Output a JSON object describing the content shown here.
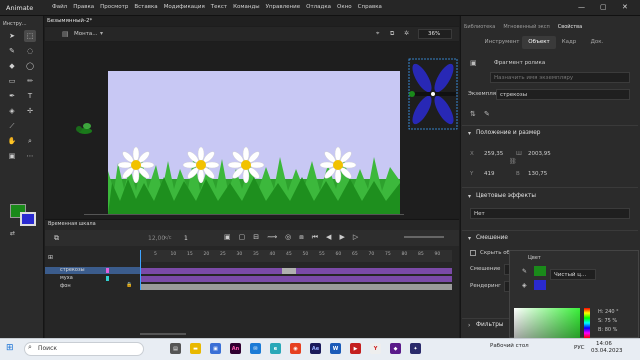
{
  "app": {
    "name": "Animate"
  },
  "menu": [
    "Файл",
    "Правка",
    "Просмотр",
    "Вставка",
    "Модификация",
    "Текст",
    "Команды",
    "Управление",
    "Отладка",
    "Окно",
    "Справка"
  ],
  "tools_panel": {
    "title": "Инстру..."
  },
  "document": {
    "tab_name": "Безымянный-2*",
    "scene_label": "Монта...",
    "zoom": "36%"
  },
  "props": {
    "top_tabs": [
      "Библиотека",
      "Мгновенный эксп",
      "Свойства"
    ],
    "tabs": [
      "Инструмент",
      "Объект",
      "Кадр",
      "Док."
    ],
    "symbol_type": "Фрагмент ролика",
    "instance_name_placeholder": "Назначить имя экземпляру",
    "instance_of_label": "Экземпляр",
    "instance_of_value": "стрекозы",
    "section_position": "Положение и размер",
    "x_label": "X",
    "x": "259,35",
    "w_label": "Ш",
    "w": "2003,95",
    "y_label": "Y",
    "y": "419",
    "h_label": "В",
    "h": "130,75",
    "section_color": "Цветовые эффекты",
    "color_effect": "Нет",
    "section_blend": "Смешение",
    "hide_object": "Скрыть объе",
    "blend_label": "Смешение",
    "render_label": "Рендеринг",
    "filters": "Фильтры"
  },
  "color_popup": {
    "title": "Цвет",
    "mode": "Чистый ц...",
    "h_label": "H:",
    "h_value": "240 °",
    "s_label": "S:",
    "s_value": "75 %",
    "b_label": "B:",
    "b_value": "80 %",
    "fill_color": "#2a2ad0",
    "stroke_color": "#1a8a1a"
  },
  "timeline": {
    "title": "Временная шкала",
    "fps": "12,00",
    "fps_unit": "к/с",
    "frame": "1",
    "ruler_numbers": [
      "5",
      "10",
      "15",
      "20",
      "25",
      "30",
      "35",
      "40",
      "45",
      "50",
      "55",
      "60",
      "65",
      "70",
      "75",
      "80",
      "85",
      "90"
    ],
    "layers": [
      "стрекозы",
      "муха",
      "фон"
    ]
  },
  "taskbar": {
    "search_placeholder": "Поиск",
    "tray_label": "Рабочий стол",
    "lang": "РУС",
    "time": "14:06",
    "date": "03.04.2023"
  },
  "colors": {
    "ui_bg": "#1d1d1d",
    "stage_bg": "#c8c8f4",
    "layer_purple": "#7b4aa8",
    "accent_blue": "#3fa3ff"
  }
}
